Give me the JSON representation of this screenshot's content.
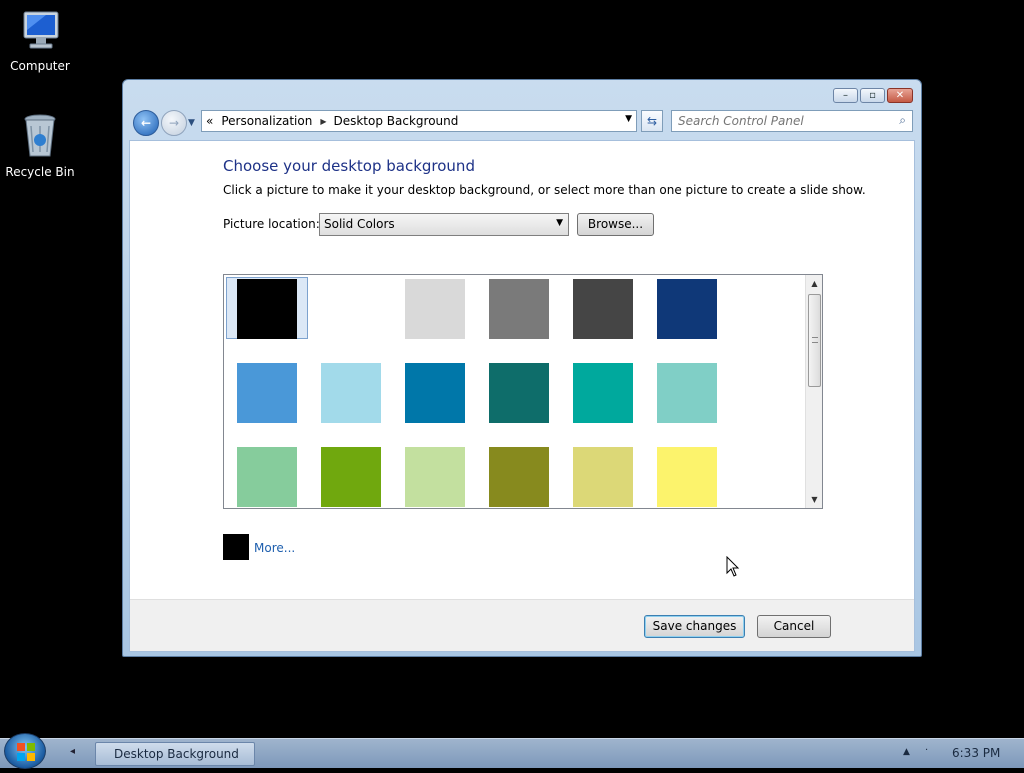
{
  "desktop": {
    "icons": [
      {
        "label": "Computer"
      },
      {
        "label": "Recycle Bin"
      }
    ]
  },
  "window": {
    "caption_buttons": [
      "minimize",
      "maximize",
      "close"
    ],
    "nav": {
      "breadcrumb_root": "«",
      "breadcrumb": [
        "Personalization",
        "Desktop Background"
      ],
      "search_placeholder": "Search Control Panel"
    },
    "content": {
      "heading": "Choose your desktop background",
      "instructions": "Click a picture to make it your desktop background, or select more than one picture to create a slide show.",
      "picture_location_label": "Picture location:",
      "picture_location_value": "Solid Colors",
      "browse_label": "Browse...",
      "swatches": [
        {
          "color": "#000000",
          "selected": true
        },
        {
          "color": "#ffffff"
        },
        {
          "color": "#d9d9d9"
        },
        {
          "color": "#7a7a7a"
        },
        {
          "color": "#454545"
        },
        {
          "color": "#0f3878"
        },
        {
          "color": "#4a98d8"
        },
        {
          "color": "#a2daea"
        },
        {
          "color": "#0077a9"
        },
        {
          "color": "#0e6d6a"
        },
        {
          "color": "#00a99d"
        },
        {
          "color": "#80cfc6"
        },
        {
          "color": "#86cc9c"
        },
        {
          "color": "#70a80e"
        },
        {
          "color": "#c3e09f"
        },
        {
          "color": "#878a1e"
        },
        {
          "color": "#dcd877"
        },
        {
          "color": "#fcf36c"
        }
      ],
      "more_label": "More...",
      "more_swatch_color": "#000000"
    },
    "footer": {
      "save_label": "Save changes",
      "cancel_label": "Cancel"
    }
  },
  "taskbar": {
    "task_label": "Desktop Background",
    "clock": "6:33 PM"
  }
}
